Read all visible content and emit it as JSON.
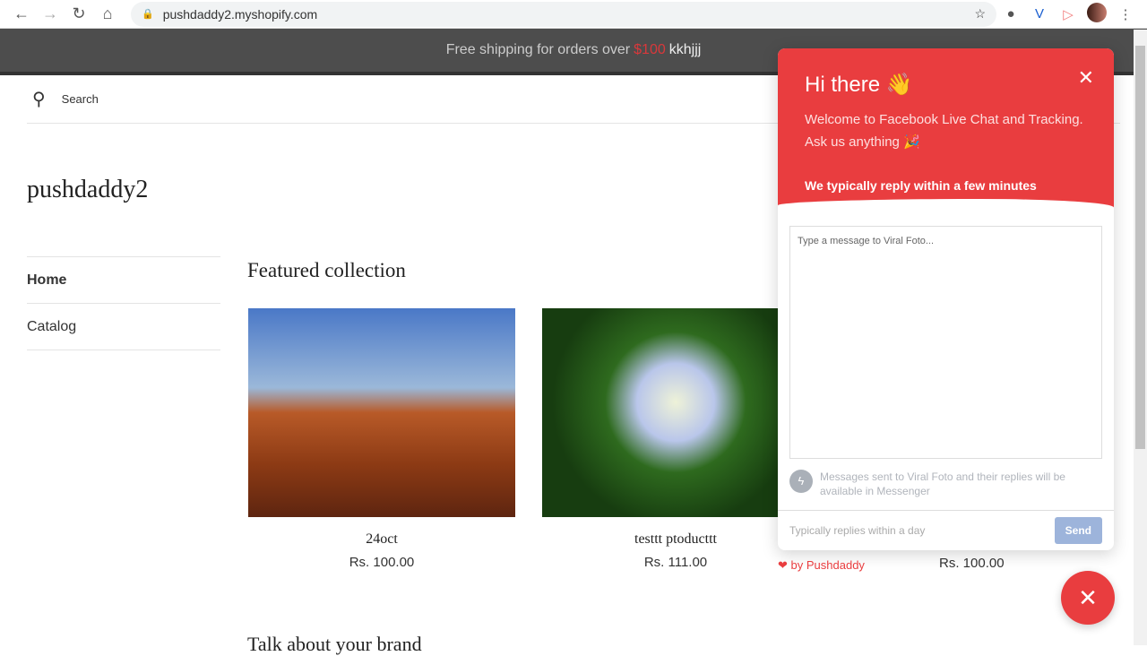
{
  "browser": {
    "url": "pushdaddy2.myshopify.com"
  },
  "banner": {
    "text": "Free shipping for orders over",
    "amount": "$100",
    "tail": "kkhjjj",
    "accent": "#d9383b"
  },
  "search": {
    "label": "Search"
  },
  "store": {
    "name": "pushdaddy2"
  },
  "menu": [
    {
      "label": "Home",
      "active": true
    },
    {
      "label": "Catalog"
    }
  ],
  "featured": {
    "title": "Featured collection",
    "products": [
      {
        "name": "24oct",
        "price": "Rs. 100.00"
      },
      {
        "name": "testtt ptoducttt",
        "price": "Rs. 111.00"
      },
      {
        "price": "Rs. 100.00"
      }
    ]
  },
  "brand_section": {
    "title": "Talk about your brand"
  },
  "chat": {
    "greeting": "Hi there",
    "greeting_emoji": "👋",
    "welcome": "Welcome to Facebook Live Chat and Tracking. Ask us anything",
    "welcome_emoji": "🎉",
    "reply_time": "We typically reply within a few minutes",
    "placeholder": "Type a message to Viral Foto...",
    "note": "Messages sent to Viral Foto and their replies will be available in Messenger",
    "footer": "Typically replies within a day",
    "send": "Send",
    "powered": "by Pushdaddy",
    "accent": "#e93d3f"
  }
}
